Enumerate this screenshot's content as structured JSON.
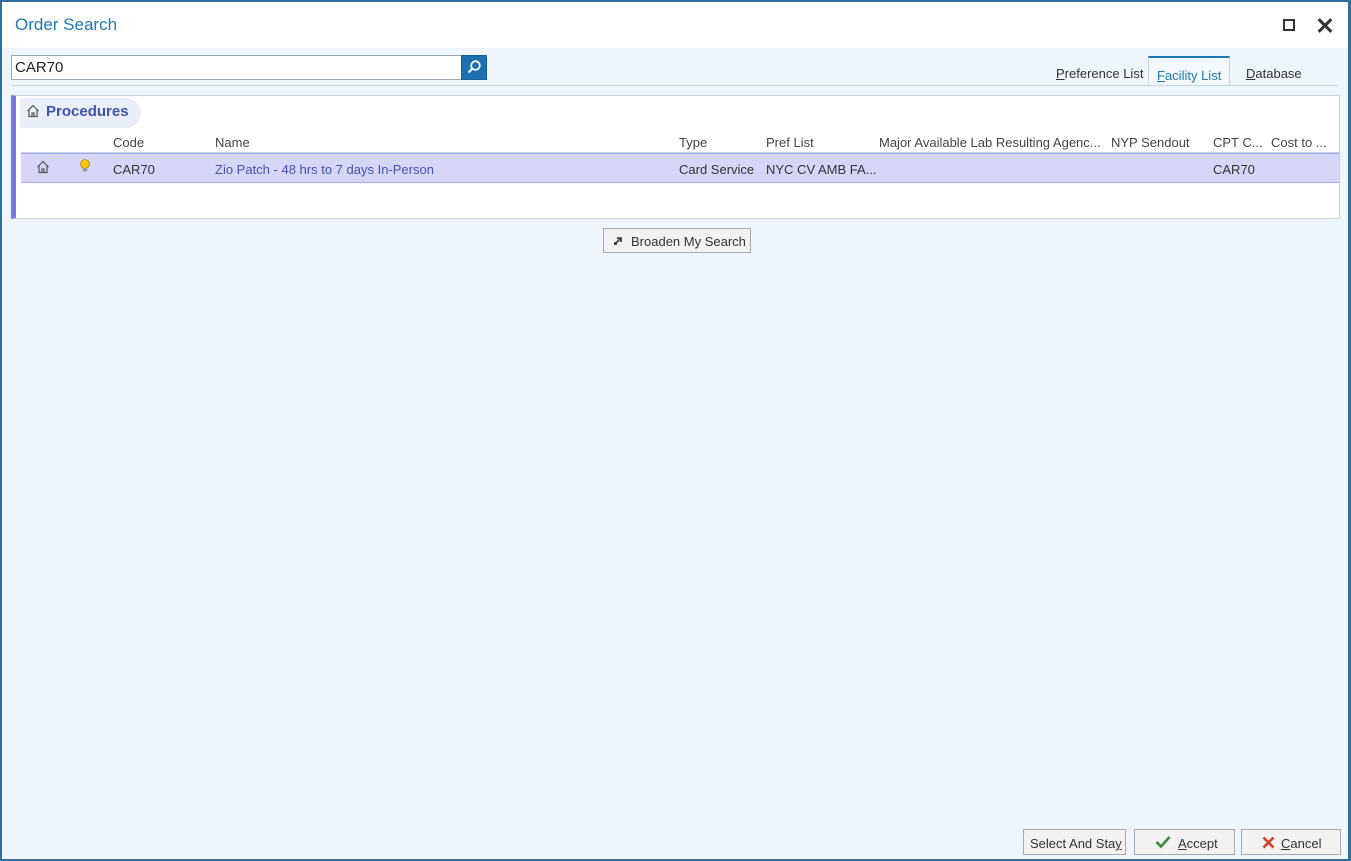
{
  "window": {
    "title": "Order Search"
  },
  "search": {
    "value": "CAR70"
  },
  "tabs": [
    {
      "first": "P",
      "rest": "reference List"
    },
    {
      "first": "F",
      "rest": "acility List",
      "active": true
    },
    {
      "first": "D",
      "rest": "atabase"
    }
  ],
  "group": {
    "title": "Procedures"
  },
  "columns": {
    "code": "Code",
    "name": "Name",
    "type": "Type",
    "pref_list": "Pref List",
    "major_lab": "Major Available Lab Resulting Agenc...",
    "nyp_sendout": "NYP Sendout",
    "cpt": "CPT C...",
    "cost": "Cost to ..."
  },
  "rows": [
    {
      "code": "CAR70",
      "name": "Zio Patch - 48 hrs to 7 days In-Person",
      "type": "Card Service",
      "pref_list": "NYC CV AMB FA...",
      "major_lab": "",
      "nyp_sendout": "",
      "cpt": "CAR70",
      "cost": ""
    }
  ],
  "broaden_label": "Broaden My Search",
  "footer": {
    "select_stay_a": "Select And Sta",
    "select_stay_u": "y",
    "accept_u": "A",
    "accept_rest": "ccept",
    "cancel_u": "C",
    "cancel_rest": "ancel"
  },
  "colors": {
    "accent": "#1d7ab5",
    "selected_row": "#d6d6f9",
    "group_bar": "#7c79e5",
    "accept_check": "#3a8a3a",
    "cancel_x": "#d04030"
  },
  "icons": {
    "search": "search-icon",
    "home": "home-icon",
    "bulb": "lightbulb-icon",
    "broaden": "expand-arrow-icon",
    "check": "check-icon",
    "cancel": "x-icon"
  }
}
